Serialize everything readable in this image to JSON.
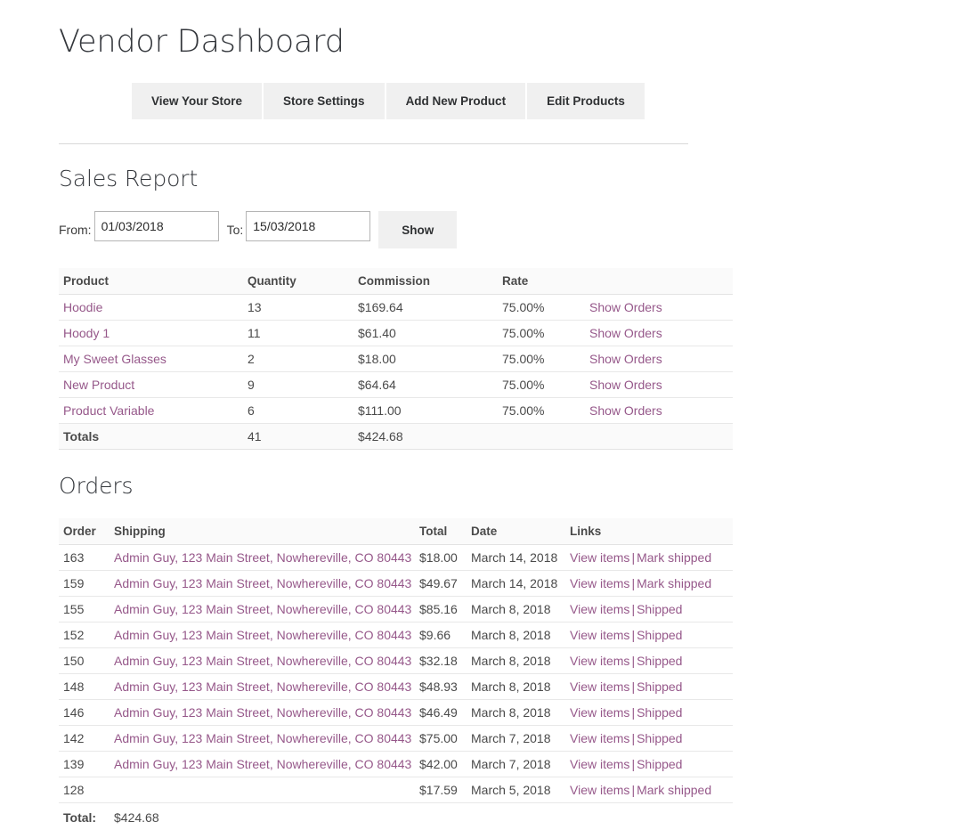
{
  "page_title": "Vendor Dashboard",
  "nav_buttons": [
    {
      "label": "View Your Store"
    },
    {
      "label": "Store Settings"
    },
    {
      "label": "Add New Product"
    },
    {
      "label": "Edit Products"
    }
  ],
  "sales_report": {
    "heading": "Sales Report",
    "filter": {
      "from_label": "From:",
      "from_value": "01/03/2018",
      "to_label": "To:",
      "to_value": "15/03/2018",
      "show_label": "Show"
    },
    "columns": [
      "Product",
      "Quantity",
      "Commission",
      "Rate",
      ""
    ],
    "rows": [
      {
        "product": "Hoodie",
        "quantity": "13",
        "commission": "$169.64",
        "rate": "75.00%",
        "link": "Show Orders"
      },
      {
        "product": "Hoody 1",
        "quantity": "11",
        "commission": "$61.40",
        "rate": "75.00%",
        "link": "Show Orders"
      },
      {
        "product": "My Sweet Glasses",
        "quantity": "2",
        "commission": "$18.00",
        "rate": "75.00%",
        "link": "Show Orders"
      },
      {
        "product": "New Product",
        "quantity": "9",
        "commission": "$64.64",
        "rate": "75.00%",
        "link": "Show Orders"
      },
      {
        "product": "Product Variable",
        "quantity": "6",
        "commission": "$111.00",
        "rate": "75.00%",
        "link": "Show Orders"
      }
    ],
    "totals": {
      "label": "Totals",
      "quantity": "41",
      "commission": "$424.68",
      "rate": "",
      "link": ""
    }
  },
  "orders": {
    "heading": "Orders",
    "columns": [
      "Order",
      "Shipping",
      "Total",
      "Date",
      "Links"
    ],
    "rows": [
      {
        "order": "163",
        "shipping": "Admin Guy, 123 Main Street, Nowhereville, CO 80443",
        "total": "$18.00",
        "date": "March 14, 2018",
        "link1": "View items",
        "sep": "|",
        "link2": "Mark shipped"
      },
      {
        "order": "159",
        "shipping": "Admin Guy, 123 Main Street, Nowhereville, CO 80443",
        "total": "$49.67",
        "date": "March 14, 2018",
        "link1": "View items",
        "sep": "|",
        "link2": "Mark shipped"
      },
      {
        "order": "155",
        "shipping": "Admin Guy, 123 Main Street, Nowhereville, CO 80443",
        "total": "$85.16",
        "date": "March 8, 2018",
        "link1": "View items",
        "sep": "|",
        "link2": "Shipped"
      },
      {
        "order": "152",
        "shipping": "Admin Guy, 123 Main Street, Nowhereville, CO 80443",
        "total": "$9.66",
        "date": "March 8, 2018",
        "link1": "View items",
        "sep": "|",
        "link2": "Shipped"
      },
      {
        "order": "150",
        "shipping": "Admin Guy, 123 Main Street, Nowhereville, CO 80443",
        "total": "$32.18",
        "date": "March 8, 2018",
        "link1": "View items",
        "sep": "|",
        "link2": "Shipped"
      },
      {
        "order": "148",
        "shipping": "Admin Guy, 123 Main Street, Nowhereville, CO 80443",
        "total": "$48.93",
        "date": "March 8, 2018",
        "link1": "View items",
        "sep": "|",
        "link2": "Shipped"
      },
      {
        "order": "146",
        "shipping": "Admin Guy, 123 Main Street, Nowhereville, CO 80443",
        "total": "$46.49",
        "date": "March 8, 2018",
        "link1": "View items",
        "sep": "|",
        "link2": "Shipped"
      },
      {
        "order": "142",
        "shipping": "Admin Guy, 123 Main Street, Nowhereville, CO 80443",
        "total": "$75.00",
        "date": "March 7, 2018",
        "link1": "View items",
        "sep": "|",
        "link2": "Shipped"
      },
      {
        "order": "139",
        "shipping": "Admin Guy, 123 Main Street, Nowhereville, CO 80443",
        "total": "$42.00",
        "date": "March 7, 2018",
        "link1": "View items",
        "sep": "|",
        "link2": "Shipped"
      },
      {
        "order": "128",
        "shipping": "",
        "total": "$17.59",
        "date": "March 5, 2018",
        "link1": "View items",
        "sep": "|",
        "link2": "Mark shipped"
      }
    ],
    "grand_total": {
      "label": "Total:",
      "value": "$424.68"
    }
  },
  "colors": {
    "link": "#96588a",
    "button_bg": "#f0f0f0",
    "heading": "#33363b",
    "text": "#4a4a4a"
  }
}
